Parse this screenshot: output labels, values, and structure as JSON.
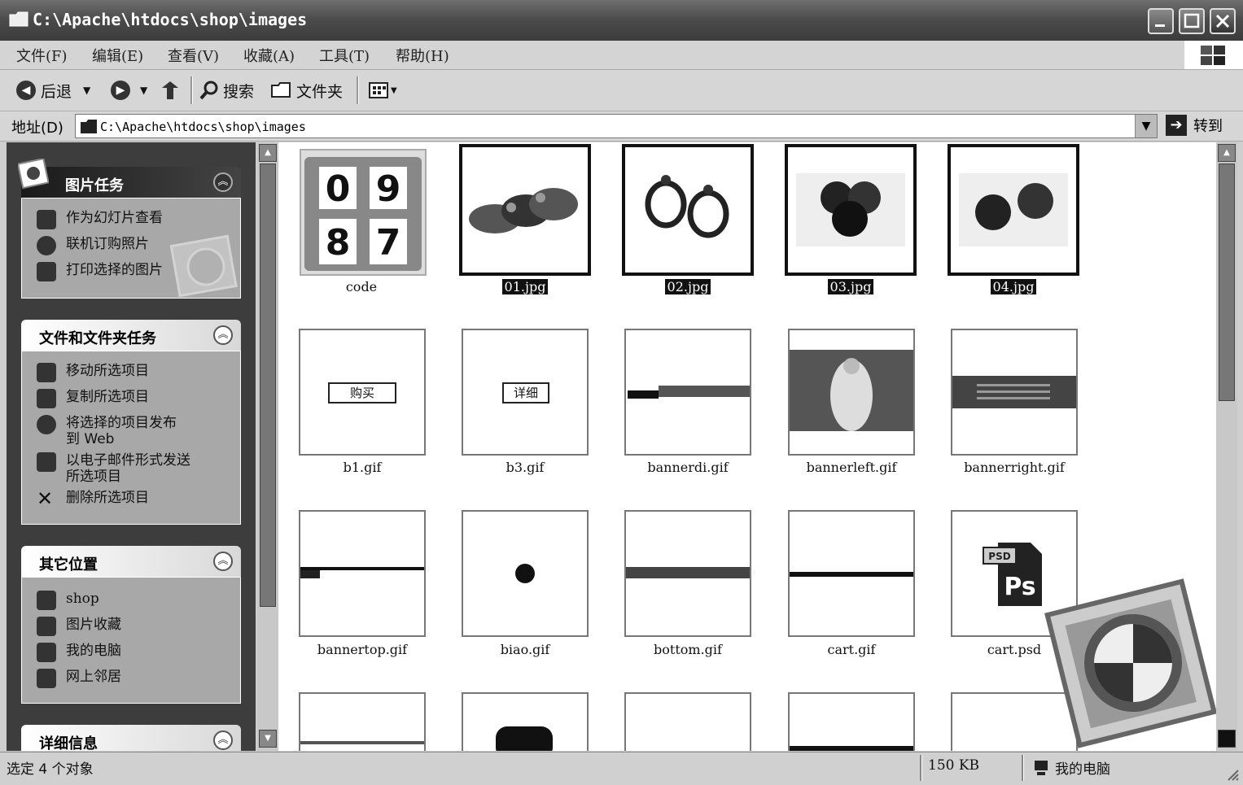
{
  "window": {
    "title": "C:\\Apache\\htdocs\\shop\\images"
  },
  "menu": [
    "文件(F)",
    "编辑(E)",
    "查看(V)",
    "收藏(A)",
    "工具(T)",
    "帮助(H)"
  ],
  "toolbar": {
    "back": "后退",
    "search": "搜索",
    "folders": "文件夹"
  },
  "address": {
    "label": "地址(D)",
    "value": "C:\\Apache\\htdocs\\shop\\images",
    "go": "转到"
  },
  "sidebar": {
    "picture_tasks": {
      "title": "图片任务",
      "items": [
        "作为幻灯片查看",
        "联机订购照片",
        "打印选择的图片"
      ]
    },
    "file_tasks": {
      "title": "文件和文件夹任务",
      "items": [
        "移动所选项目",
        "复制所选项目",
        "将选择的项目发布到 Web",
        "以电子邮件形式发送所选项目",
        "删除所选项目"
      ]
    },
    "other_places": {
      "title": "其它位置",
      "items": [
        "shop",
        "图片收藏",
        "我的电脑",
        "网上邻居"
      ]
    },
    "details": {
      "title": "详细信息"
    }
  },
  "files": [
    {
      "name": "code",
      "selected": false
    },
    {
      "name": "01.jpg",
      "selected": true
    },
    {
      "name": "02.jpg",
      "selected": true
    },
    {
      "name": "03.jpg",
      "selected": true
    },
    {
      "name": "04.jpg",
      "selected": true
    },
    {
      "name": "b1.gif",
      "selected": false,
      "text": "购买"
    },
    {
      "name": "b3.gif",
      "selected": false,
      "text": "详细"
    },
    {
      "name": "bannerdi.gif",
      "selected": false
    },
    {
      "name": "bannerleft.gif",
      "selected": false
    },
    {
      "name": "bannerright.gif",
      "selected": false
    },
    {
      "name": "bannertop.gif",
      "selected": false
    },
    {
      "name": "biao.gif",
      "selected": false
    },
    {
      "name": "bottom.gif",
      "selected": false
    },
    {
      "name": "cart.gif",
      "selected": false
    },
    {
      "name": "cart.psd",
      "selected": false,
      "badge": "PSD",
      "ps": "Ps"
    }
  ],
  "code_digits": [
    "0",
    "9",
    "8",
    "7"
  ],
  "status": {
    "selection": "选定 4 个对象",
    "size": "150 KB",
    "location": "我的电脑"
  }
}
